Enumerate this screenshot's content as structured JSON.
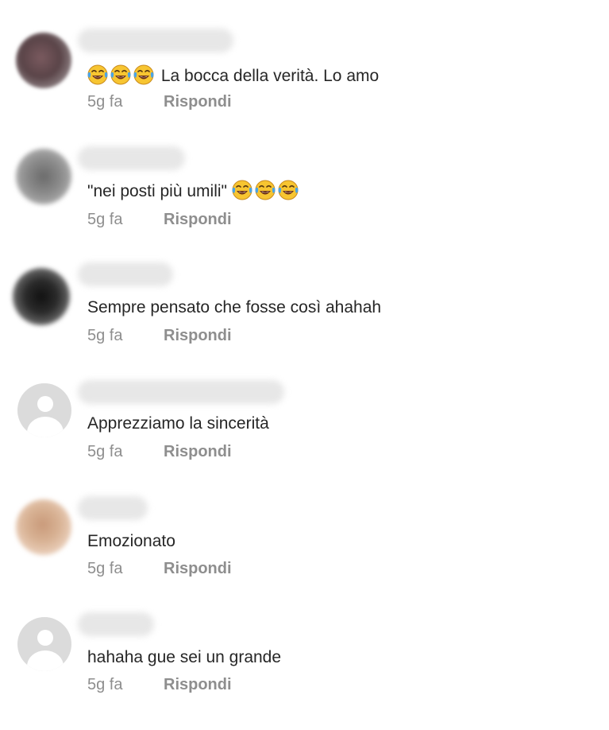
{
  "comments": [
    {
      "avatar": "blurred-photo",
      "text": "La bocca della verità. Lo amo",
      "emoji_prefix": [
        "face-with-tears-of-joy",
        "face-with-tears-of-joy",
        "face-with-tears-of-joy"
      ],
      "time": "5g fa",
      "reply_label": "Rispondi"
    },
    {
      "avatar": "blurred-photo",
      "text": "\"nei posti più umili\"",
      "emoji_suffix": [
        "face-with-tears-of-joy",
        "face-with-tears-of-joy",
        "face-with-tears-of-joy"
      ],
      "time": "5g fa",
      "reply_label": "Rispondi"
    },
    {
      "avatar": "blurred-photo",
      "text": "Sempre pensato che fosse così ahahah",
      "time": "5g fa",
      "reply_label": "Rispondi"
    },
    {
      "avatar": "default-profile-icon",
      "text": "Apprezziamo la sincerità",
      "time": "5g fa",
      "reply_label": "Rispondi"
    },
    {
      "avatar": "blurred-photo",
      "text": "Emozionato",
      "time": "5g fa",
      "reply_label": "Rispondi"
    },
    {
      "avatar": "default-profile-icon",
      "text": "hahaha gue sei un grande",
      "time": "5g fa",
      "reply_label": "Rispondi"
    }
  ]
}
